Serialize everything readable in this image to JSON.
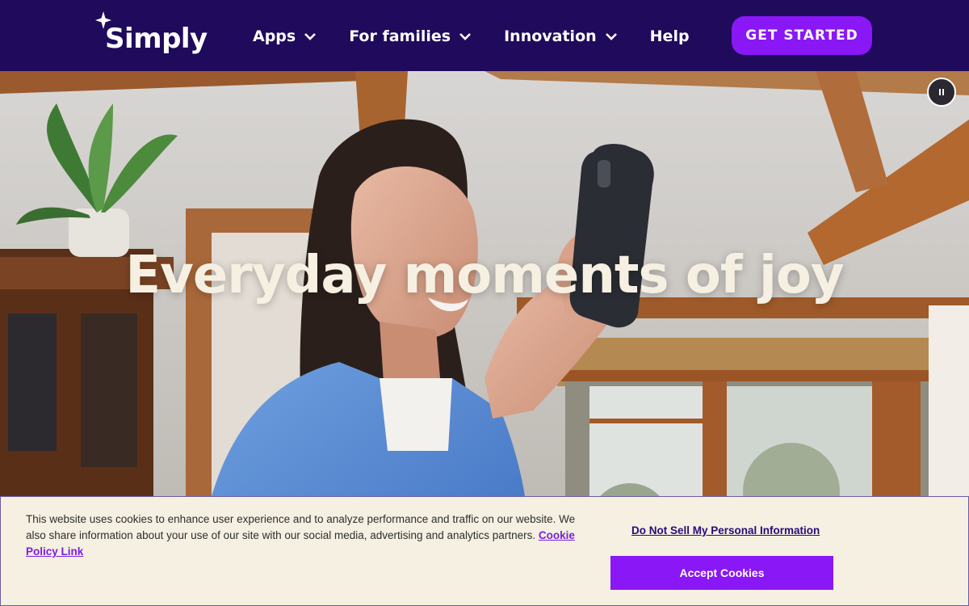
{
  "header": {
    "logo_text": "Simply",
    "nav": [
      {
        "label": "Apps",
        "has_dropdown": true
      },
      {
        "label": "For families",
        "has_dropdown": true
      },
      {
        "label": "Innovation",
        "has_dropdown": true
      },
      {
        "label": "Help",
        "has_dropdown": false
      }
    ],
    "cta_label": "GET STARTED"
  },
  "hero": {
    "title": "Everyday moments of joy",
    "video_control_icon": "pause-icon"
  },
  "cookie_banner": {
    "text": "This website uses cookies to enhance user experience and to analyze performance and traffic on our website. We also share information about your use of our site with our social media, advertising and analytics partners.",
    "policy_link": "Cookie Policy Link",
    "dns_link": "Do Not Sell My Personal Information",
    "accept_label": "Accept Cookies"
  },
  "colors": {
    "header_bg": "#1f0a5c",
    "accent": "#8a17f5",
    "banner_bg": "#f5f0e1",
    "hero_text": "#f6f0e2"
  }
}
